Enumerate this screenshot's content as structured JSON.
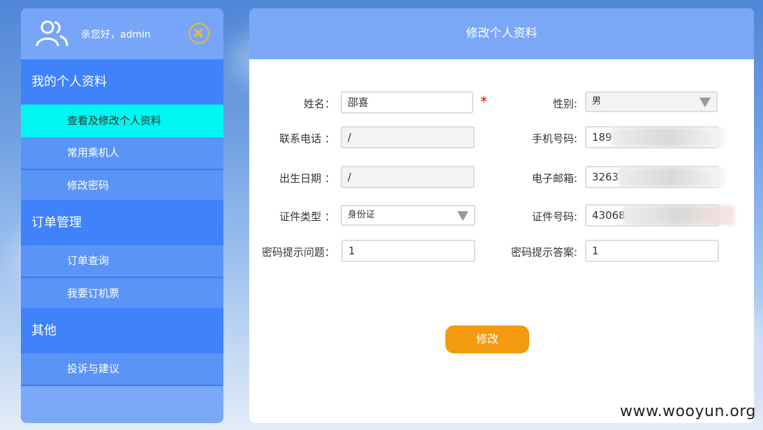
{
  "sidebar": {
    "greeting": "亲您好，admin",
    "sections": [
      {
        "title": "我的个人资料",
        "items": [
          "查看及修改个人资料",
          "常用乘机人",
          "修改密码"
        ]
      },
      {
        "title": "订单管理",
        "items": [
          "订单查询",
          "我要订机票"
        ]
      },
      {
        "title": "其他",
        "items": [
          "投诉与建议"
        ]
      }
    ],
    "active_item": "查看及修改个人资料"
  },
  "panel": {
    "title": "修改个人资料",
    "form": {
      "name_label": "姓名：",
      "name_value": "邵喜",
      "required_mark": "*",
      "gender_label": "性别:",
      "gender_value": "男",
      "phone_label": "联系电话 ：",
      "phone_value": "/",
      "mobile_label": "手机号码:",
      "mobile_value": "189",
      "birth_label": "出生日期 ：",
      "birth_value": "/",
      "email_label": "电子邮箱:",
      "email_value": "3263",
      "idtype_label": "证件类型 ：",
      "idtype_value": "身份证",
      "idno_label": "证件号码:",
      "idno_value": "43068",
      "question_label": "密码提示问题：",
      "question_value": "1",
      "answer_label": "密码提示答案:",
      "answer_value": "1"
    },
    "submit_label": "修改"
  },
  "watermark": "www.wooyun.org",
  "colors": {
    "sidebar_section": "#3f82fa",
    "sidebar_item": "#5a94f7",
    "active_item": "#00f6f0",
    "header": "#7aa8f7",
    "submit": "#f39a0e",
    "required": "#e00000"
  }
}
